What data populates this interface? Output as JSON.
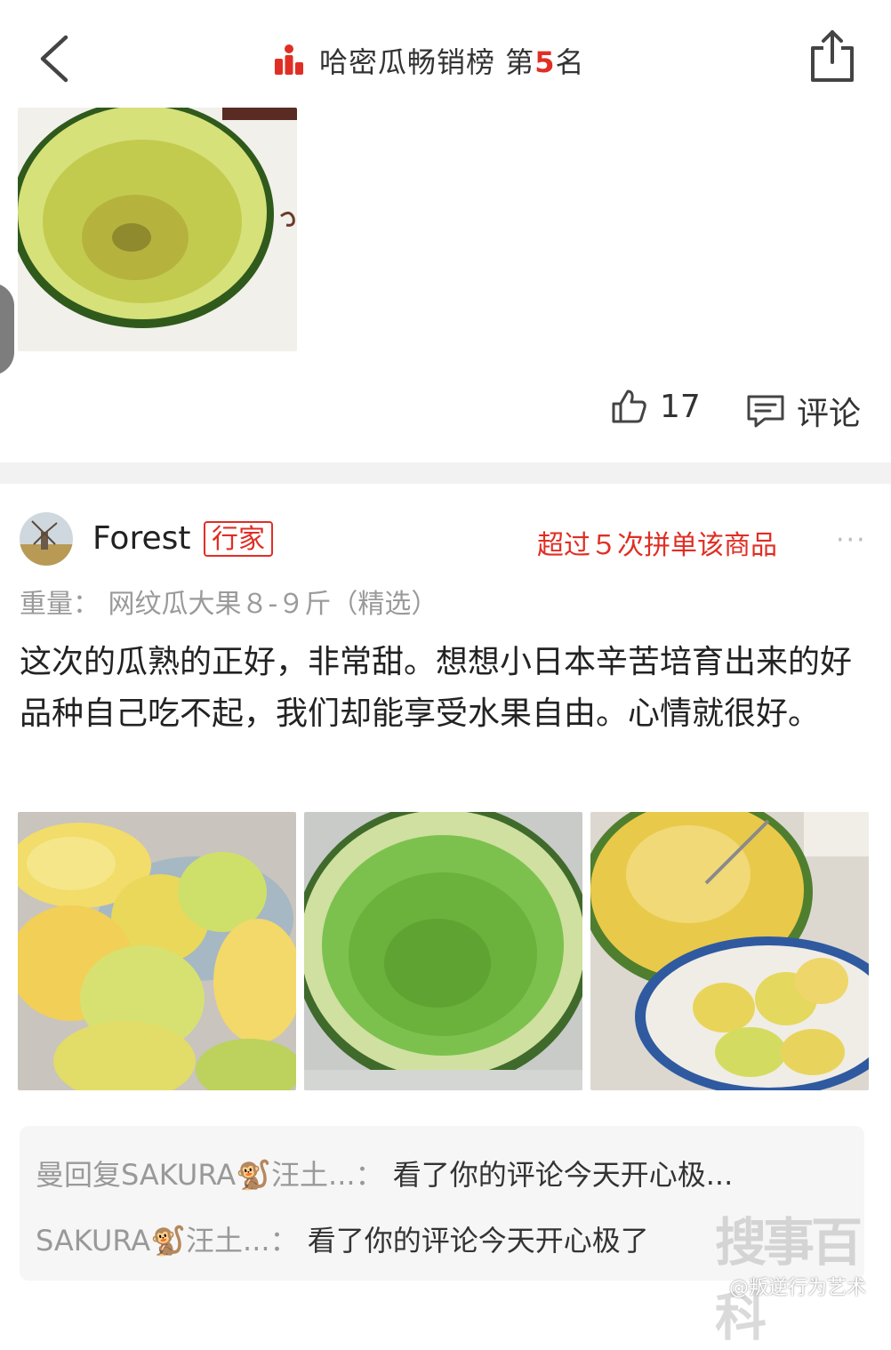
{
  "header": {
    "title_prefix": "哈密瓜畅销榜 第",
    "rank_number": "5",
    "title_suffix": "名",
    "back_icon": "chevron-left-icon",
    "share_icon": "share-icon",
    "accent_color": "#e02e24"
  },
  "previous_review": {
    "likes": "17",
    "comment_label": "评论"
  },
  "review": {
    "username": "Forest",
    "badge": "行家",
    "group_buy_note": "超过５次拼单该商品",
    "more_label": "···",
    "spec_label": "重量：",
    "spec_value": "网纹瓜大果８-９斤（精选）",
    "text": "这次的瓜熟的正好，非常甜。想想小日本辛苦培育出来的好品种自己吃不起，我们却能享受水果自由。心情就很好。"
  },
  "replies": [
    {
      "name": "曼回复SAKURA🐒汪土...：",
      "text": "看了你的评论今天开心极..."
    },
    {
      "name": "SAKURA🐒汪土...：",
      "text": "看了你的评论今天开心极了"
    }
  ],
  "watermark": {
    "handle": "@叛逆行为艺术",
    "logo_text": "搜事百科"
  }
}
